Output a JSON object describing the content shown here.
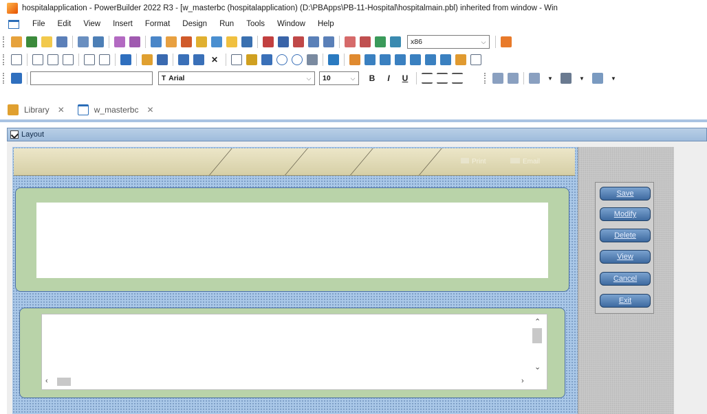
{
  "window": {
    "title": "hospitalapplication - PowerBuilder 2022 R3 - [w_masterbc (hospitalapplication) (D:\\PBApps\\PB-11-Hospital\\hospitalmain.pbl) inherited from window - Win"
  },
  "menu": {
    "items": [
      "File",
      "Edit",
      "View",
      "Insert",
      "Format",
      "Design",
      "Run",
      "Tools",
      "Window",
      "Help"
    ]
  },
  "toolbar": {
    "platform_value": "x86",
    "font_value": "Arial",
    "font_icon": "T",
    "size_value": "10",
    "bold": "B",
    "italic": "I",
    "underline": "U"
  },
  "tabs": [
    {
      "label": "Library",
      "close": "✕",
      "icon": "library-icon"
    },
    {
      "label": "w_masterbc",
      "close": "✕",
      "icon": "window-icon"
    }
  ],
  "layout": {
    "header_label": "Layout",
    "print_label": "Print",
    "email_label": "Email"
  },
  "buttons": [
    "Save",
    "Modify",
    "Delete",
    "View",
    "Cancel",
    "Exit"
  ],
  "colors": {
    "accent_blue": "#3e6aa0",
    "design_bg": "#aac8e8",
    "group_bg": "#b9d3a9",
    "header_band": "#d6cfa6"
  }
}
